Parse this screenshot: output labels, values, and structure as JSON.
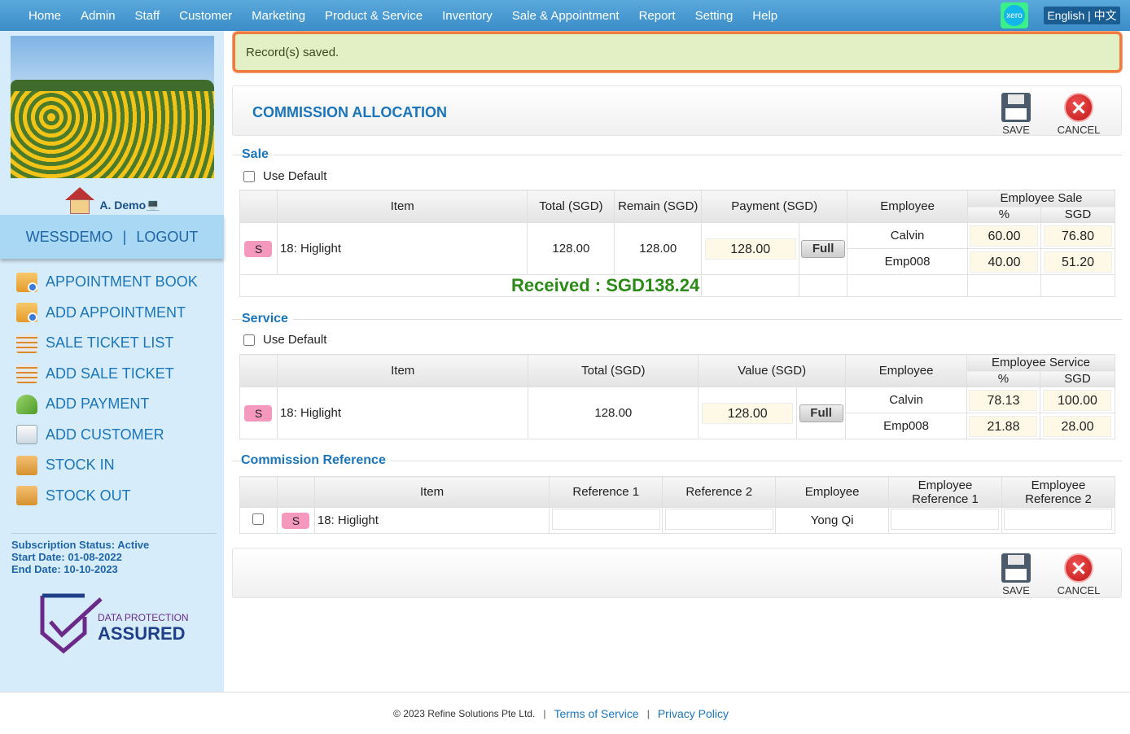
{
  "nav": {
    "items": [
      "Home",
      "Admin",
      "Staff",
      "Customer",
      "Marketing",
      "Product & Service",
      "Inventory",
      "Sale & Appointment",
      "Report",
      "Setting",
      "Help"
    ],
    "xero": "xero",
    "language": "English | 中文"
  },
  "sidebar": {
    "user_name": "A. Demo",
    "account": "WESSDEMO",
    "logout": "LOGOUT",
    "menu": [
      {
        "label": "APPOINTMENT BOOK",
        "icon": "calendar-icon"
      },
      {
        "label": "ADD APPOINTMENT",
        "icon": "calendar-add-icon"
      },
      {
        "label": "SALE TICKET LIST",
        "icon": "ticket-list-icon"
      },
      {
        "label": "ADD SALE TICKET",
        "icon": "ticket-add-icon"
      },
      {
        "label": "ADD PAYMENT",
        "icon": "payment-icon"
      },
      {
        "label": "ADD CUSTOMER",
        "icon": "customer-icon"
      },
      {
        "label": "STOCK IN",
        "icon": "stock-in-icon"
      },
      {
        "label": "STOCK OUT",
        "icon": "stock-out-icon"
      }
    ],
    "subscription": {
      "status": "Subscription Status: Active",
      "start": "Start Date: 01-08-2022",
      "end": "End Date: 10-10-2023"
    },
    "badge": {
      "line1": "DATA PROTECTION",
      "line2": "ASSURED"
    }
  },
  "alert": "Record(s) saved.",
  "page_title": "COMMISSION ALLOCATION",
  "actions": {
    "save": "SAVE",
    "cancel": "CANCEL"
  },
  "sale": {
    "title": "Sale",
    "use_default": "Use Default",
    "headers": {
      "item": "Item",
      "total": "Total (SGD)",
      "remain": "Remain (SGD)",
      "payment": "Payment (SGD)",
      "employee": "Employee",
      "emp_group": "Employee Sale",
      "pct": "%",
      "sgd": "SGD"
    },
    "row": {
      "badge": "S",
      "item": "18: Higlight",
      "total": "128.00",
      "remain": "128.00",
      "payment": "128.00",
      "full": "Full"
    },
    "employees": [
      {
        "name": "Calvin",
        "pct": "60.00",
        "sgd": "76.80"
      },
      {
        "name": "Emp008",
        "pct": "40.00",
        "sgd": "51.20"
      }
    ],
    "received": "Received : SGD138.24"
  },
  "service": {
    "title": "Service",
    "use_default": "Use Default",
    "headers": {
      "item": "Item",
      "total": "Total (SGD)",
      "value": "Value (SGD)",
      "employee": "Employee",
      "emp_group": "Employee Service",
      "pct": "%",
      "sgd": "SGD"
    },
    "row": {
      "badge": "S",
      "item": "18: Higlight",
      "total": "128.00",
      "value": "128.00",
      "full": "Full"
    },
    "employees": [
      {
        "name": "Calvin",
        "pct": "78.13",
        "sgd": "100.00"
      },
      {
        "name": "Emp008",
        "pct": "21.88",
        "sgd": "28.00"
      }
    ]
  },
  "reference": {
    "title": "Commission Reference",
    "headers": {
      "item": "Item",
      "ref1": "Reference 1",
      "ref2": "Reference 2",
      "employee": "Employee",
      "emp_ref1_a": "Employee",
      "emp_ref1_b": "Reference 1",
      "emp_ref2_a": "Employee",
      "emp_ref2_b": "Reference 2"
    },
    "row": {
      "badge": "S",
      "item": "18: Higlight",
      "ref1": "",
      "ref2": "",
      "employee": "Yong Qi",
      "emp_ref1": "",
      "emp_ref2": ""
    }
  },
  "footer": {
    "copyright": "© 2023 Refine Solutions Pte Ltd.",
    "sep": "|",
    "terms": "Terms of Service",
    "privacy": "Privacy Policy"
  }
}
